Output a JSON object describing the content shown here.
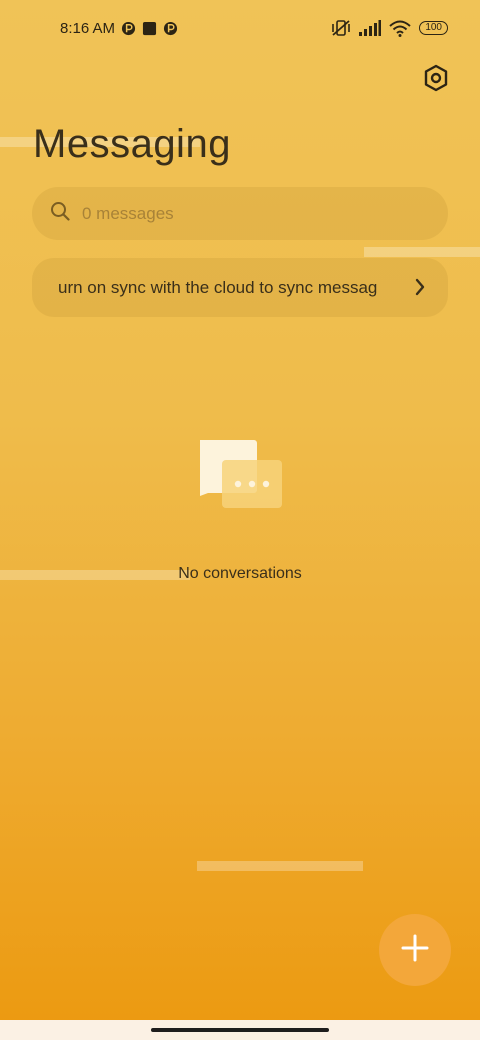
{
  "status_bar": {
    "time": "8:16 AM",
    "left_icons": [
      "app-notification-icon",
      "square-notification-icon",
      "app-notification-icon"
    ],
    "right_icons": [
      "vibrate-off-icon",
      "signal-icon",
      "wifi-icon"
    ],
    "battery": "100"
  },
  "header": {
    "title": "Messaging",
    "settings_icon": "settings-icon"
  },
  "search": {
    "placeholder": "0 messages",
    "icon": "search-icon"
  },
  "sync_banner": {
    "text": "urn on sync with the cloud to sync messag",
    "icon": "chevron-right-icon"
  },
  "empty_state": {
    "text": "No conversations",
    "icon": "chat-bubbles-icon"
  },
  "fab": {
    "icon": "plus-icon"
  },
  "colors": {
    "gradient_top": "#f0c357",
    "gradient_bottom": "#ec990f",
    "fab": "#f3a73a",
    "text": "#3a2f1a"
  }
}
